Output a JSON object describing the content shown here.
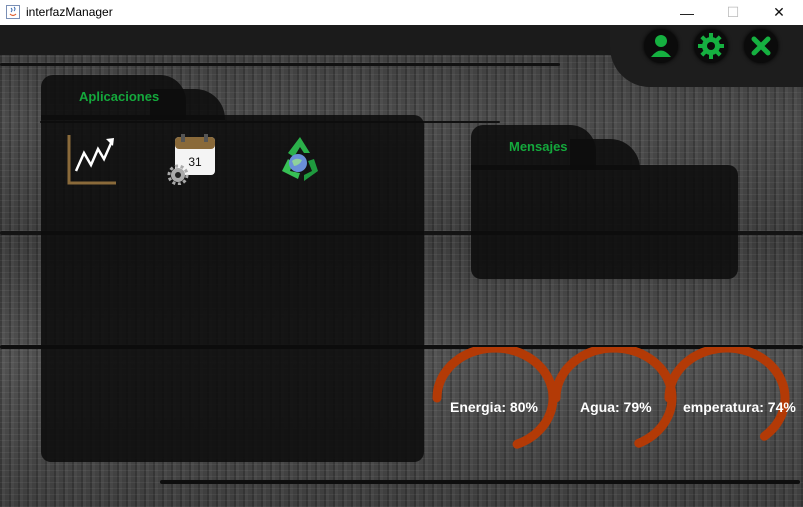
{
  "window": {
    "title": "interfazManager",
    "min": "—",
    "max": "☐",
    "close": "✕"
  },
  "toolbar": {
    "user": "user-icon",
    "settings": "gear-icon",
    "close": "close-icon"
  },
  "panels": {
    "apps_title": "Aplicaciones",
    "messages_title": "Mensajes"
  },
  "apps": [
    {
      "name": "chart-icon"
    },
    {
      "name": "calendar-icon",
      "day": "31"
    },
    {
      "name": "recycle-icon"
    }
  ],
  "gauges": [
    {
      "label": "Energia: 80%",
      "value": 0.8
    },
    {
      "label": "Agua: 79%",
      "value": 0.79
    },
    {
      "label": "emperatura: 74%",
      "value": 0.74
    }
  ],
  "colors": {
    "accent": "#14a83c",
    "gauge": "#b33a06",
    "panel": "#0c0c0c"
  }
}
